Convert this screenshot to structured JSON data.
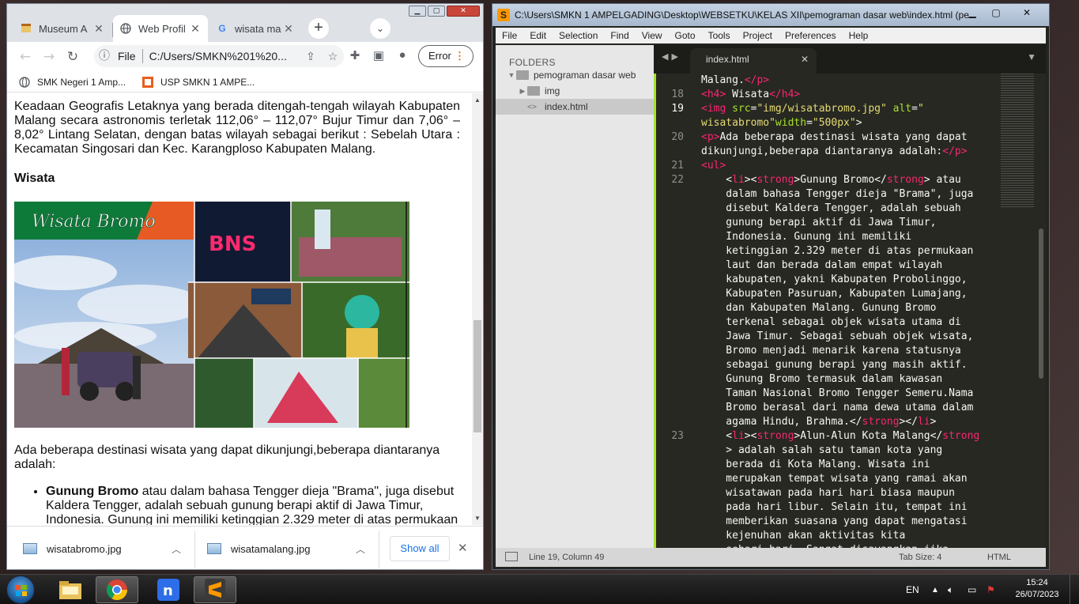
{
  "chrome": {
    "tabs": [
      {
        "label": "Museum A",
        "icon": "museum-favicon"
      },
      {
        "label": "Web Profil",
        "icon": "globe-icon"
      },
      {
        "label": "wisata ma",
        "icon": "google-icon"
      }
    ],
    "address": {
      "scheme_label": "File",
      "url": "C:/Users/SMKN%201%20..."
    },
    "error_label": "Error",
    "bookmarks": [
      {
        "label": "SMK Negeri 1 Amp...",
        "icon": "globe-icon"
      },
      {
        "label": "USP SMKN 1 AMPE...",
        "icon": "usp-icon"
      }
    ],
    "content": {
      "para1": "Keadaan Geografis Letaknya yang berada ditengah-tengah wilayah Kabupaten Malang secara astronomis terletak 112,06° – 112,07° Bujur Timur dan 7,06° – 8,02° Lintang Selatan, dengan batas wilayah sebagai berikut : Sebelah Utara : Kecamatan Singosari dan Kec. Karangploso Kabupaten Malang.",
      "heading": "Wisata",
      "collage": {
        "banner": "Wisata Bromo",
        "sign": "BNS"
      },
      "para2": "Ada beberapa destinasi wisata yang dapat dikunjungi,beberapa diantaranya adalah:",
      "list": [
        {
          "strong": "Gunung Bromo",
          "text": " atau dalam bahasa Tengger dieja \"Brama\", juga disebut Kaldera Tengger, adalah sebuah gunung berapi aktif di Jawa Timur, Indonesia. Gunung ini memiliki ketinggian 2.329 meter di atas permukaan"
        }
      ]
    },
    "downloads": {
      "items": [
        "wisatabromo.jpg",
        "wisatamalang.jpg"
      ],
      "show_all": "Show all"
    }
  },
  "sublime": {
    "title": "C:\\Users\\SMKN 1 AMPELGADING\\Desktop\\WEBSETKU\\KELAS XII\\pemograman dasar web\\index.html (pe...",
    "menu": [
      "File",
      "Edit",
      "Selection",
      "Find",
      "View",
      "Goto",
      "Tools",
      "Project",
      "Preferences",
      "Help"
    ],
    "sidebar": {
      "header": "FOLDERS",
      "root": "pemograman dasar web",
      "children": [
        "img",
        "index.html"
      ]
    },
    "tab": "index.html",
    "gutter": [
      "18",
      "19",
      "20",
      "21",
      "22",
      "23"
    ],
    "status": {
      "position": "Line 19, Column 49",
      "tab_size": "Tab Size: 4",
      "syntax": "HTML"
    }
  },
  "taskbar": {
    "language": "EN",
    "time": "15:24",
    "date": "26/07/2023"
  }
}
